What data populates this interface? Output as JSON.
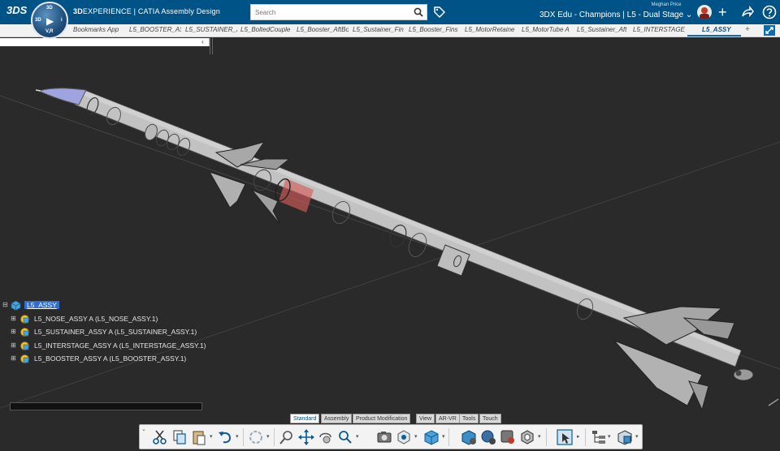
{
  "app": {
    "brand_bold": "3D",
    "brand_rest": "EXPERIENCE | CATIA ",
    "brand_app": "Assembly Design",
    "logo": "3DS",
    "compass_labels": {
      "top": "3D",
      "left": "3D",
      "right": "i",
      "bottom": "V,R"
    }
  },
  "search": {
    "placeholder": "Search"
  },
  "header": {
    "user_name": "Meghan Price",
    "context": "3DX Edu - Champions | L5 - Dual Stage",
    "context_caret": "⌄"
  },
  "tabs": [
    {
      "label": "Bookmarks App"
    },
    {
      "label": "L5_BOOSTER_AS"
    },
    {
      "label": "L5_SUSTAINER_A"
    },
    {
      "label": "L5_BoltedCouple"
    },
    {
      "label": "L5_Booster_AftBo"
    },
    {
      "label": "L5_Sustainer_Fin"
    },
    {
      "label": "L5_Booster_Fins"
    },
    {
      "label": "L5_MotorRetaine"
    },
    {
      "label": "L5_MotorTube A"
    },
    {
      "label": "L5_Sustainer_Aft"
    },
    {
      "label": "L5_INTERSTAGE_"
    },
    {
      "label": "L5_ASSY"
    }
  ],
  "tab_add": "+",
  "tree": {
    "root": "L5_ASSY",
    "children": [
      {
        "label": "L5_NOSE_ASSY A (L5_NOSE_ASSY.1)"
      },
      {
        "label": "L5_SUSTAINER_ASSY A (L5_SUSTAINER_ASSY.1)"
      },
      {
        "label": "L5_INTERSTAGE_ASSY A (L5_INTERSTAGE_ASSY.1)"
      },
      {
        "label": "L5_BOOSTER_ASSY A (L5_BOOSTER_ASSY.1)"
      }
    ]
  },
  "section_tabs": [
    {
      "label": "Standard",
      "active": true
    },
    {
      "label": "Assembly"
    },
    {
      "label": "Product Modification"
    },
    {
      "label": "View"
    },
    {
      "label": "AR-VR"
    },
    {
      "label": "Tools"
    },
    {
      "label": "Touch"
    }
  ],
  "toolbar_icons": [
    "cut-icon",
    "copy-icon",
    "paste-icon",
    "undo-icon",
    "update-icon",
    "zoom-icon",
    "pan-icon",
    "rotate-icon",
    "search-zoom-icon",
    "capture-icon",
    "render-mode-icon",
    "view-cube-icon",
    "product-icon",
    "part-icon",
    "material-icon",
    "shape-icon",
    "select-icon",
    "tree-icon",
    "section-icon"
  ],
  "colors": {
    "topbar": "#005386",
    "accent": "#0b6db0",
    "viewport_bg": "#2a2a2a",
    "nose": "#9fa4e0",
    "body": "#c4c4c4",
    "interstage_highlight": "#d35c58"
  }
}
